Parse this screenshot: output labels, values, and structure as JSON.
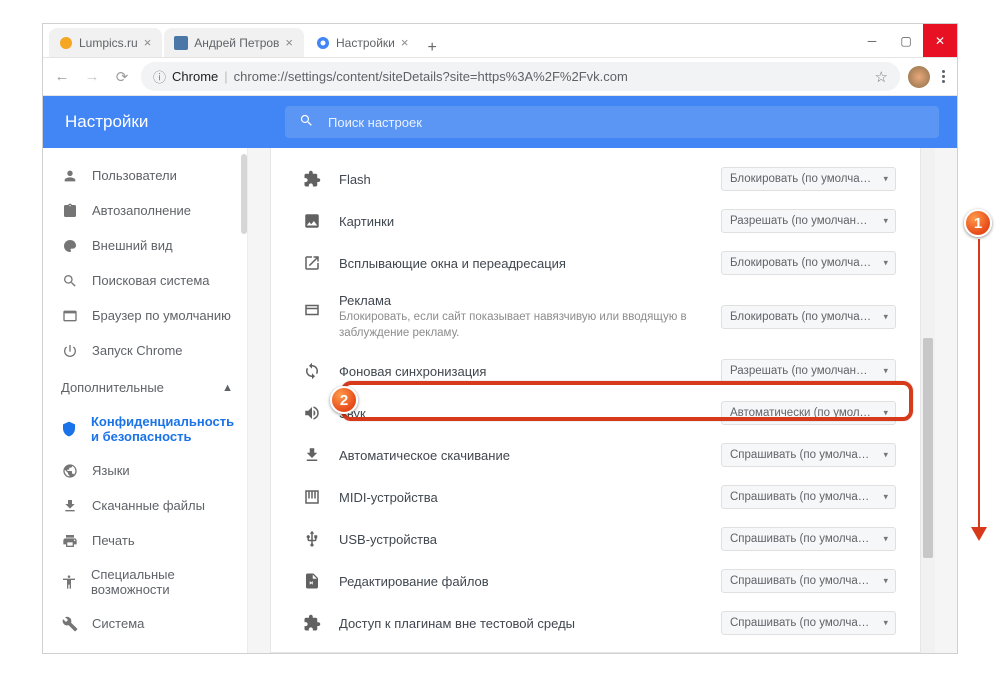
{
  "tabs": {
    "t0": {
      "title": "Lumpics.ru"
    },
    "t1": {
      "title": "Андрей Петров"
    },
    "t2": {
      "title": "Настройки"
    }
  },
  "url": {
    "chrome_label": "Chrome",
    "path": "chrome://settings/content/siteDetails?site=https%3A%2F%2Fvk.com"
  },
  "header": {
    "title": "Настройки",
    "search_placeholder": "Поиск настроек"
  },
  "sidebar": {
    "items": {
      "0": {
        "label": "Пользователи"
      },
      "1": {
        "label": "Автозаполнение"
      },
      "2": {
        "label": "Внешний вид"
      },
      "3": {
        "label": "Поисковая система"
      },
      "4": {
        "label": "Браузер по умолчанию"
      },
      "5": {
        "label": "Запуск Chrome"
      }
    },
    "section_advanced": "Дополнительные",
    "adv": {
      "0": {
        "label": "Конфиденциальность и безопасность"
      },
      "1": {
        "label": "Языки"
      },
      "2": {
        "label": "Скачанные файлы"
      },
      "3": {
        "label": "Печать"
      },
      "4": {
        "label": "Специальные возможности"
      },
      "5": {
        "label": "Система"
      }
    }
  },
  "perms": {
    "0": {
      "label": "Flash",
      "value": "Блокировать (по умолчанию)"
    },
    "1": {
      "label": "Картинки",
      "value": "Разрешать (по умолчанию)"
    },
    "2": {
      "label": "Всплывающие окна и переадресация",
      "value": "Блокировать (по умолчанию)"
    },
    "3": {
      "label": "Реклама",
      "sub": "Блокировать, если сайт показывает навязчивую или вводящую в заблуждение рекламу.",
      "value": "Блокировать (по умолчанию)"
    },
    "4": {
      "label": "Фоновая синхронизация",
      "value": "Разрешать (по умолчанию)"
    },
    "5": {
      "label": "Звук",
      "value": "Автоматически (по умолчан"
    },
    "6": {
      "label": "Автоматическое скачивание",
      "value": "Спрашивать (по умолчанию)"
    },
    "7": {
      "label": "MIDI-устройства",
      "value": "Спрашивать (по умолчанию)"
    },
    "8": {
      "label": "USB-устройства",
      "value": "Спрашивать (по умолчанию)"
    },
    "9": {
      "label": "Редактирование файлов",
      "value": "Спрашивать (по умолчанию)"
    },
    "10": {
      "label": "Доступ к плагинам вне тестовой среды",
      "value": "Спрашивать (по умолчанию)"
    }
  },
  "callouts": {
    "a": "1",
    "b": "2"
  }
}
